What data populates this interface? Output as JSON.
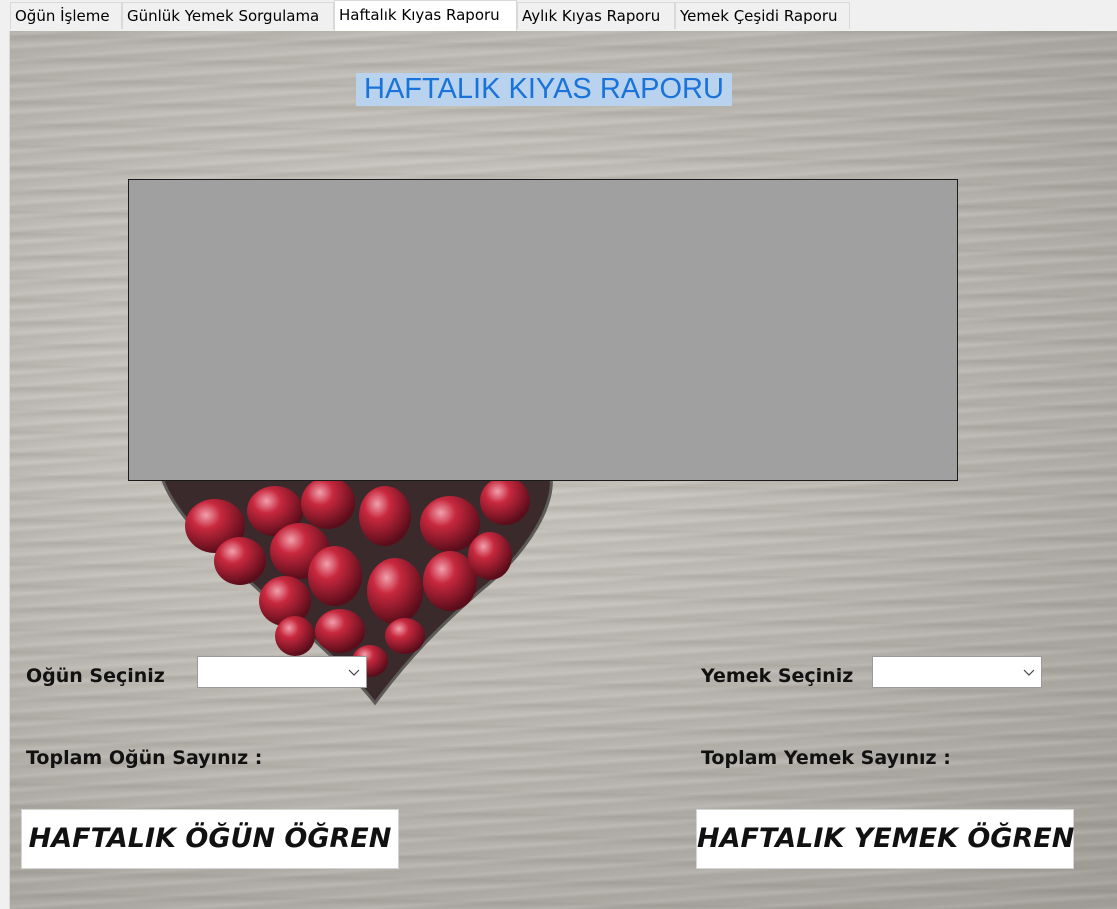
{
  "tabs": [
    {
      "label": "Oğün İşleme",
      "active": false
    },
    {
      "label": "Günlük Yemek Sorgulama",
      "active": false
    },
    {
      "label": "Haftalık Kıyas Raporu",
      "active": true
    },
    {
      "label": "Aylık Kıyas Raporu",
      "active": false
    },
    {
      "label": "Yemek Çeşidi Raporu",
      "active": false
    }
  ],
  "page": {
    "title": "HAFTALIK KIYAS RAPORU",
    "title_color": "#1a73d9",
    "title_background": "#b9d3ee"
  },
  "report_panel": {
    "background": "#a0a0a0"
  },
  "meal_section": {
    "select_label": "Oğün Seçiniz",
    "select_value": "",
    "total_label": "Toplam Oğün Sayınız :",
    "button_label": "HAFTALIK ÖĞÜN ÖĞREN"
  },
  "food_section": {
    "select_label": "Yemek Seçiniz",
    "select_value": "",
    "total_label": "Toplam Yemek Sayınız :",
    "button_label": "HAFTALIK YEMEK ÖĞREN"
  },
  "icons": {
    "dropdown": "chevron-down-icon"
  }
}
